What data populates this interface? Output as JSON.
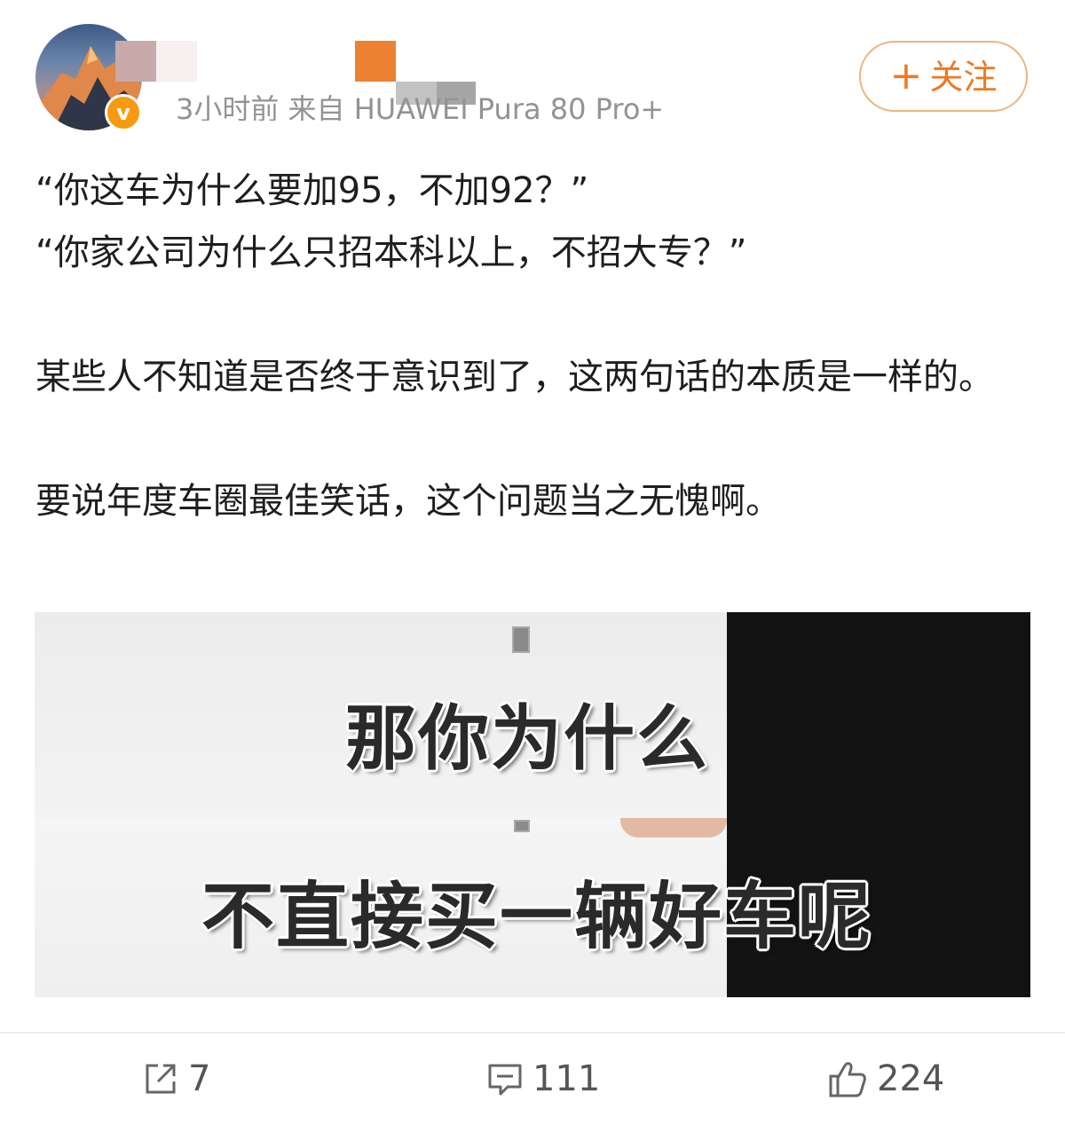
{
  "post": {
    "meta_text": "3小时前  来自 HUAWEI Pura 80 Pro+",
    "follow_label": "关注",
    "follow_plus": "+",
    "verified_badge": "v",
    "lines": [
      "“你这车为什么要加95，不加92？”",
      "“你家公司为什么只招本科以上，不招大专？”",
      "",
      "某些人不知道是否终于意识到了，这两句话的本质是一样的。",
      "",
      "要说年度车圈最佳笑话，这个问题当之无愧啊。"
    ]
  },
  "media": {
    "caption_top": "那你为什么",
    "caption_bottom": "不直接买一辆好车呢"
  },
  "actions": {
    "repost_count": "7",
    "comment_count": "111",
    "like_count": "224"
  },
  "colors": {
    "accent": "#ee7a23",
    "badge": "#f79a0f"
  },
  "icons": [
    "repost-icon",
    "comment-icon",
    "like-icon"
  ]
}
